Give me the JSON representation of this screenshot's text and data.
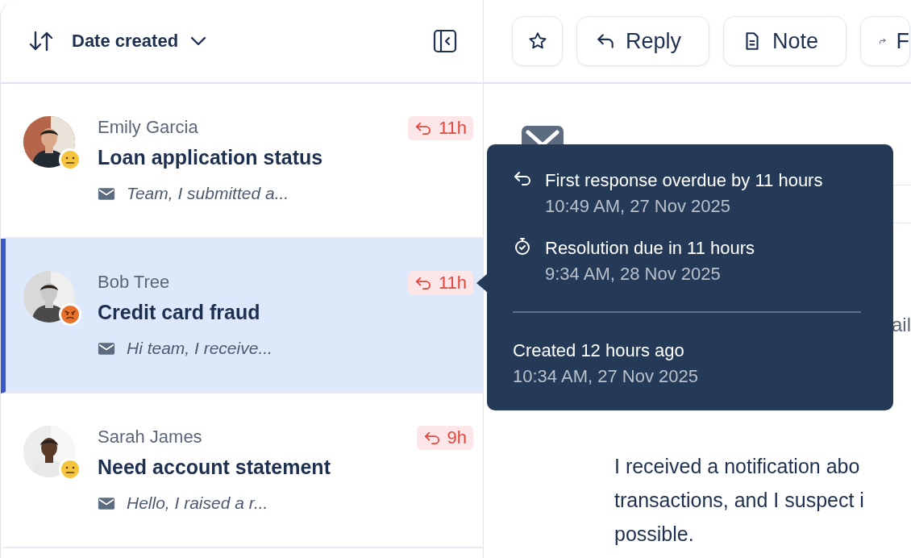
{
  "list_header": {
    "sort_label": "Date created"
  },
  "tickets": [
    {
      "name": "Emily Garcia",
      "subject": "Loan application status",
      "preview": "Team, I submitted a...",
      "sla": "11h",
      "kind": "neutral",
      "selected": false
    },
    {
      "name": "Bob Tree",
      "subject": "Credit card fraud",
      "preview": "Hi team, I receive...",
      "sla": "11h",
      "kind": "angry",
      "selected": true
    },
    {
      "name": "Sarah James",
      "subject": "Need account statement",
      "preview": "Hello, I raised a r...",
      "sla": "9h",
      "kind": "neutral",
      "selected": false
    }
  ],
  "toolbar": {
    "buttons": [
      {
        "kind": "star"
      },
      {
        "kind": "reply",
        "label": "Reply"
      },
      {
        "kind": "note",
        "label": "Note"
      },
      {
        "kind": "forward",
        "label": "F"
      }
    ]
  },
  "conversation": {
    "label_fragment": "ail",
    "body_lines": [
      "I received a notification abo",
      "transactions, and I suspect i",
      "possible."
    ]
  },
  "tooltip": {
    "items": [
      {
        "kind": "response",
        "title": "First response overdue by 11 hours",
        "time": "10:49 AM, 27 Nov 2025"
      },
      {
        "kind": "resolution",
        "title": "Resolution due in 11 hours",
        "time": "9:34 AM, 28 Nov 2025"
      },
      {
        "kind": "created",
        "title": "Created 12 hours ago",
        "time": "10:34 AM, 27 Nov 2025"
      }
    ]
  }
}
